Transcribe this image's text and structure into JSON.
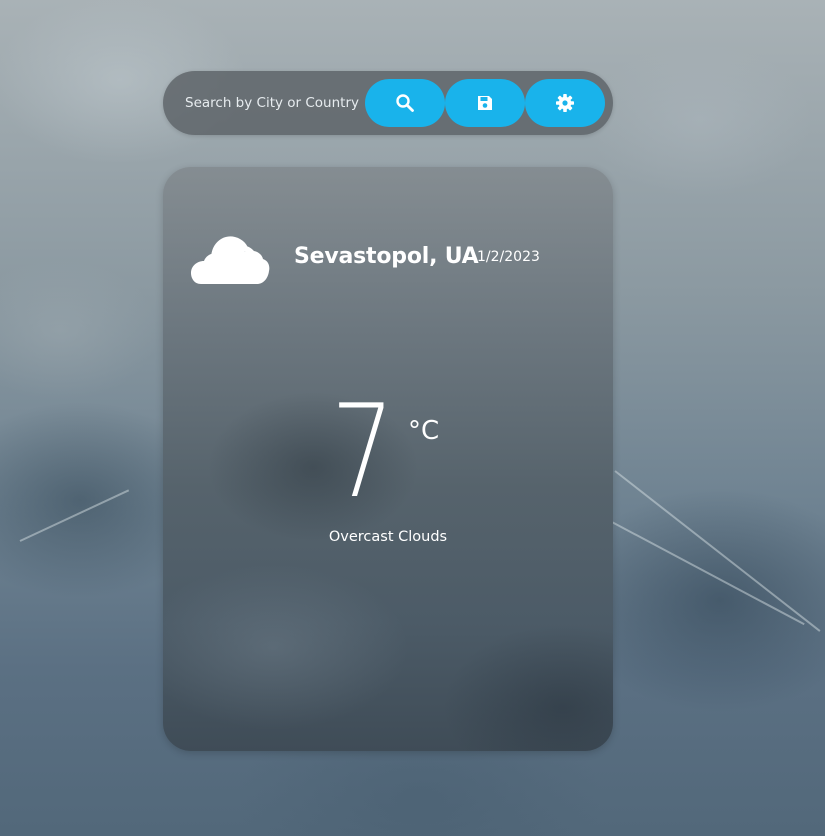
{
  "search": {
    "placeholder": "Search by City or Country"
  },
  "toolbar": {
    "search_icon": "search-icon",
    "save_icon": "save-icon",
    "settings_icon": "gear-icon",
    "accent": "#19b3eb"
  },
  "weather": {
    "icon": "cloud-icon",
    "location": "Sevastopol, UA",
    "date": "1/2/2023",
    "temperature": "7",
    "unit": "°C",
    "condition": "Overcast Clouds"
  }
}
